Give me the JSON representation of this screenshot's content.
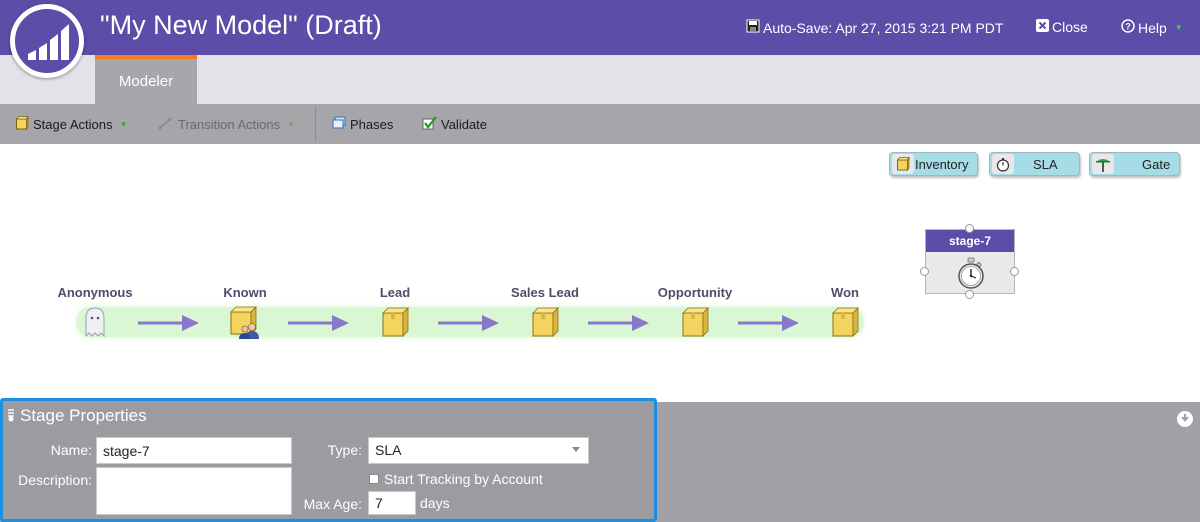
{
  "header": {
    "title": "\"My New Model\" (Draft)",
    "autosave_label": "Auto-Save: Apr 27, 2015 3:21 PM PDT",
    "close_label": "Close",
    "help_label": "Help",
    "brand_color": "#5c4da8",
    "accent_color": "#f37c21"
  },
  "tabs": [
    {
      "label": "Modeler",
      "active": true
    }
  ],
  "toolbar": {
    "stage_actions": "Stage Actions",
    "transition_actions": "Transition Actions",
    "phases": "Phases",
    "validate": "Validate"
  },
  "palette": {
    "inventory": "Inventory",
    "sla": "SLA",
    "gate": "Gate"
  },
  "canvas": {
    "selected_stage": {
      "name": "stage-7",
      "icon": "stopwatch-icon"
    },
    "flow": [
      {
        "label": "Anonymous",
        "icon": "ghost-icon"
      },
      {
        "label": "Known",
        "icon": "box-with-person-icon"
      },
      {
        "label": "Lead",
        "icon": "box-icon"
      },
      {
        "label": "Sales Lead",
        "icon": "box-icon"
      },
      {
        "label": "Opportunity",
        "icon": "box-icon"
      },
      {
        "label": "Won",
        "icon": "box-icon"
      }
    ]
  },
  "properties": {
    "title": "Stage Properties",
    "name_label": "Name:",
    "name_value": "stage-7",
    "description_label": "Description:",
    "description_value": "",
    "type_label": "Type:",
    "type_value": "SLA",
    "start_tracking_label": "Start Tracking by Account",
    "start_tracking_checked": false,
    "max_age_label": "Max Age:",
    "max_age_value": "7",
    "max_age_unit": "days"
  }
}
